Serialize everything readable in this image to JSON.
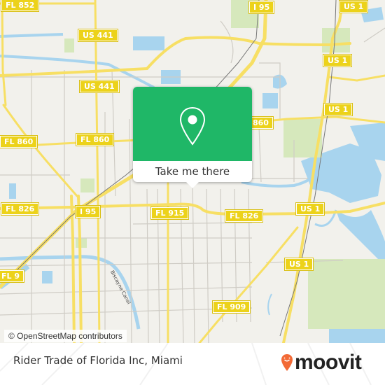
{
  "map": {
    "colors": {
      "land": "#f2f1ec",
      "water": "#a8d4ee",
      "park": "#d6e8bc",
      "major_road": "#f7df64",
      "minor_road": "#cfccc5",
      "rail": "#777777"
    },
    "route_shields": [
      {
        "label": "FL 852"
      },
      {
        "label": "US 441"
      },
      {
        "label": "US 441"
      },
      {
        "label": "I 95"
      },
      {
        "label": "US 1"
      },
      {
        "label": "US 1"
      },
      {
        "label": "US 1"
      },
      {
        "label": "FL 860"
      },
      {
        "label": "FL 860"
      },
      {
        "label": "860"
      },
      {
        "label": "FL 826"
      },
      {
        "label": "I 95"
      },
      {
        "label": "FL 915"
      },
      {
        "label": "FL 826"
      },
      {
        "label": "US 1"
      },
      {
        "label": "US 1"
      },
      {
        "label": "FL 9"
      },
      {
        "label": "FL 909"
      }
    ],
    "water_labels": [
      {
        "label": "Biscayne Canal"
      }
    ],
    "attribution": "© OpenStreetMap contributors"
  },
  "popup": {
    "icon": "location-pin-icon",
    "color": "#1fb767",
    "cta_label": "Take me there"
  },
  "footer": {
    "place_name": "Rider Trade of Florida Inc, Miami",
    "brand": {
      "name": "moovit",
      "logo_icon": "moovit-pin-icon",
      "accent": "#f26a36"
    }
  }
}
